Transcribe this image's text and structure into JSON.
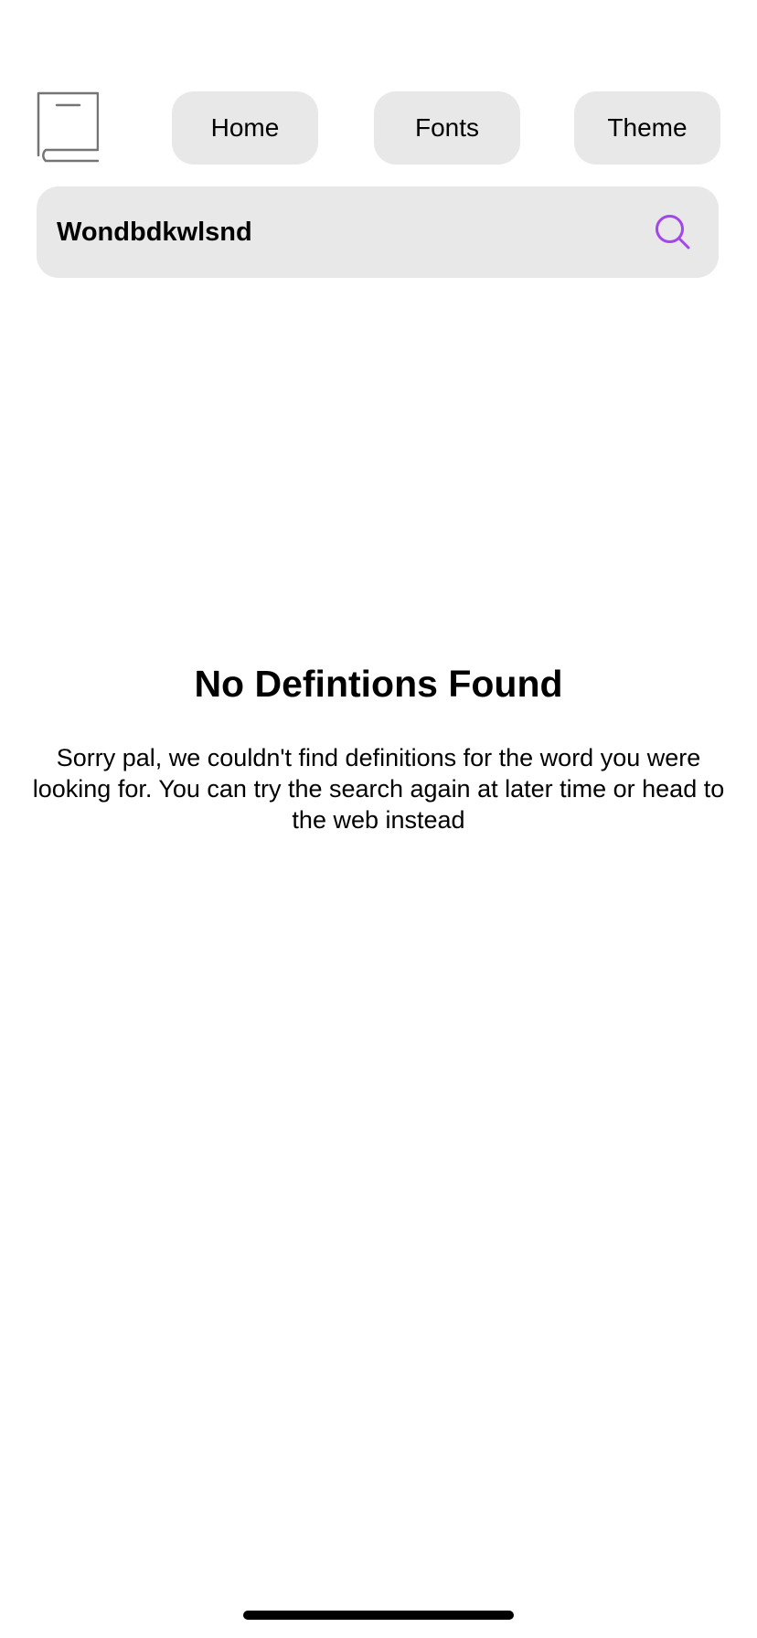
{
  "colors": {
    "background": "#ffffff",
    "button_background": "#e8e8e8",
    "accent": "#a445ed",
    "logo_stroke": "#757575",
    "text": "#000000"
  },
  "header": {
    "logo_icon": "book-icon",
    "nav": [
      {
        "label": "Home"
      },
      {
        "label": "Fonts"
      },
      {
        "label": "Theme"
      }
    ]
  },
  "search": {
    "value": "Wondbdkwlsnd",
    "icon": "search-icon"
  },
  "empty_state": {
    "title": "No Defintions Found",
    "message": "Sorry pal, we couldn't find definitions for the word you were looking for. You can try the search again at later time or head to the web instead"
  }
}
